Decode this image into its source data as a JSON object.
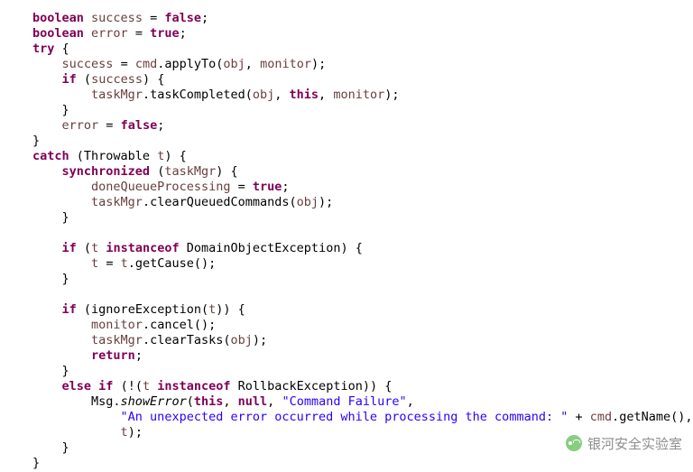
{
  "watermark": "银河安全实验室",
  "code": {
    "l1": {
      "a": "boolean",
      "b": "success",
      "c": "=",
      "d": "false",
      "e": ";"
    },
    "l2": {
      "a": "boolean",
      "b": "error",
      "c": "=",
      "d": "true",
      "e": ";"
    },
    "l3": {
      "a": "try",
      "b": "{"
    },
    "l4": {
      "a": "success",
      "b": "=",
      "c": "cmd",
      "d": ".applyTo(",
      "e": "obj",
      "f": ",",
      "g": "monitor",
      "h": ");"
    },
    "l5": {
      "a": "if",
      "b": "(",
      "c": "success",
      "d": ") {"
    },
    "l6": {
      "a": "taskMgr",
      "b": ".taskCompleted(",
      "c": "obj",
      "d": ",",
      "e": "this",
      "f": ",",
      "g": "monitor",
      "h": ");"
    },
    "l7": {
      "a": "}"
    },
    "l8": {
      "a": "error",
      "b": "=",
      "c": "false",
      "d": ";"
    },
    "l9": {
      "a": "}"
    },
    "l10": {
      "a": "catch",
      "b": "(Throwable",
      "c": "t",
      "d": ") {"
    },
    "l11": {
      "a": "synchronized",
      "b": "(",
      "c": "taskMgr",
      "d": ") {"
    },
    "l12": {
      "a": "doneQueueProcessing",
      "b": "=",
      "c": "true",
      "d": ";"
    },
    "l13": {
      "a": "taskMgr",
      "b": ".clearQueuedCommands(",
      "c": "obj",
      "d": ");"
    },
    "l14": {
      "a": "}"
    },
    "l16": {
      "a": "if",
      "b": "(",
      "c": "t",
      "d": "instanceof",
      "e": "DomainObjectException) {"
    },
    "l17": {
      "a": "t",
      "b": "=",
      "c": "t",
      "d": ".getCause();"
    },
    "l18": {
      "a": "}"
    },
    "l20": {
      "a": "if",
      "b": "(ignoreException(",
      "c": "t",
      "d": ")) {"
    },
    "l21": {
      "a": "monitor",
      "b": ".cancel();"
    },
    "l22": {
      "a": "taskMgr",
      "b": ".clearTasks(",
      "c": "obj",
      "d": ");"
    },
    "l23": {
      "a": "return",
      "b": ";"
    },
    "l24": {
      "a": "}"
    },
    "l25": {
      "a": "else if",
      "b": "(!(",
      "c": "t",
      "d": "instanceof",
      "e": "RollbackException)) {"
    },
    "l26": {
      "a": "Msg.",
      "b": "showError",
      "c": "(",
      "d": "this",
      "e": ",",
      "f": "null",
      "g": ",",
      "h": "\"Command Failure\"",
      "i": ","
    },
    "l27": {
      "a": "\"An unexpected error occurred while processing the command: \"",
      "b": "+",
      "c": "cmd",
      "d": ".getName(),"
    },
    "l28": {
      "a": "t",
      "b": ");"
    },
    "l29": {
      "a": "}"
    },
    "l30": {
      "a": "}"
    }
  }
}
